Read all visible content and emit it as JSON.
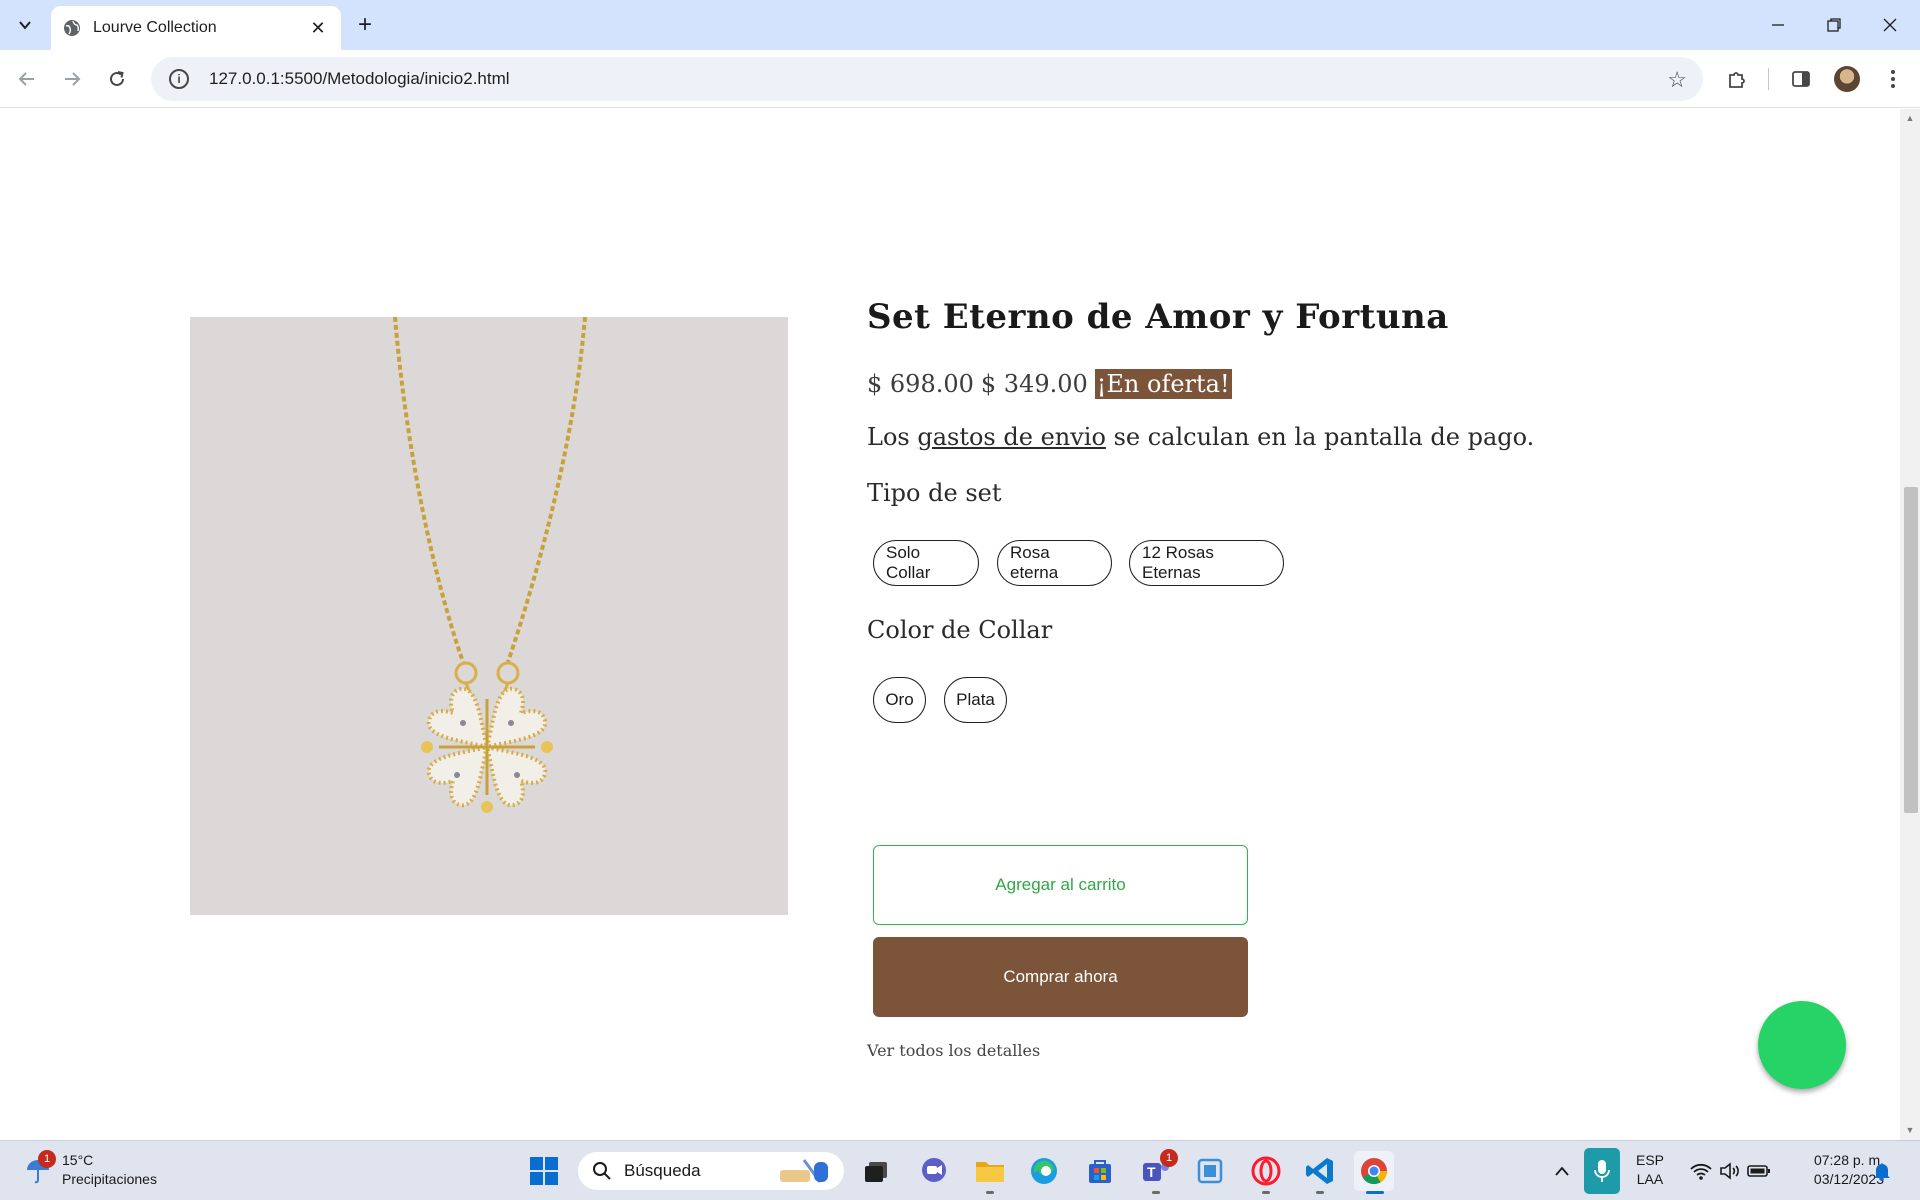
{
  "browser": {
    "tab_title": "Lourve Collection",
    "url": "127.0.0.1:5500/Metodologia/inicio2.html"
  },
  "product": {
    "title": "Set Eterno de Amor y Fortuna",
    "original_price": "$ 698.00",
    "sale_price": "$ 349.00",
    "sale_badge": "¡En oferta!",
    "shipping_prefix": "Los",
    "shipping_link": "gastos de envio",
    "shipping_suffix": "se calculan en la pantalla de pago.",
    "set_type_label": "Tipo de set",
    "set_types": [
      "Solo Collar",
      "Rosa eterna",
      "12 Rosas Eternas"
    ],
    "color_label": "Color de Collar",
    "colors": [
      "Oro",
      "Plata"
    ],
    "add_to_cart": "Agregar al carrito",
    "buy_now": "Comprar ahora",
    "view_details": "Ver todos los detalles"
  },
  "colors": {
    "brand_brown": "#7c543a",
    "cart_green": "#2fb84a",
    "whatsapp_green": "#25d366"
  },
  "taskbar": {
    "weather_temp": "15°C",
    "weather_desc": "Precipitaciones",
    "weather_badge": "1",
    "search_placeholder": "Búsqueda",
    "teams_badge": "1",
    "lang_line1": "ESP",
    "lang_line2": "LAA",
    "time": "07:28 p. m.",
    "date": "03/12/2023"
  }
}
